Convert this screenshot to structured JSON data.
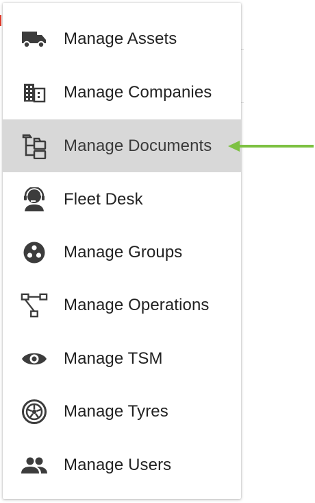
{
  "menu": {
    "items": [
      {
        "label": "Manage Assets",
        "icon": "truck-icon"
      },
      {
        "label": "Manage Companies",
        "icon": "building-icon"
      },
      {
        "label": "Manage Documents",
        "icon": "document-tree-icon",
        "active": true
      },
      {
        "label": "Fleet Desk",
        "icon": "support-agent-icon"
      },
      {
        "label": "Manage Groups",
        "icon": "groups-icon"
      },
      {
        "label": "Manage Operations",
        "icon": "operations-flow-icon"
      },
      {
        "label": "Manage TSM",
        "icon": "eye-icon"
      },
      {
        "label": "Manage Tyres",
        "icon": "tyre-icon"
      },
      {
        "label": "Manage Users",
        "icon": "users-icon"
      }
    ]
  },
  "colors": {
    "active_background": "#d8d8d8",
    "icon": "#3c3c3c",
    "text": "#222222",
    "arrow": "#7dc142"
  }
}
